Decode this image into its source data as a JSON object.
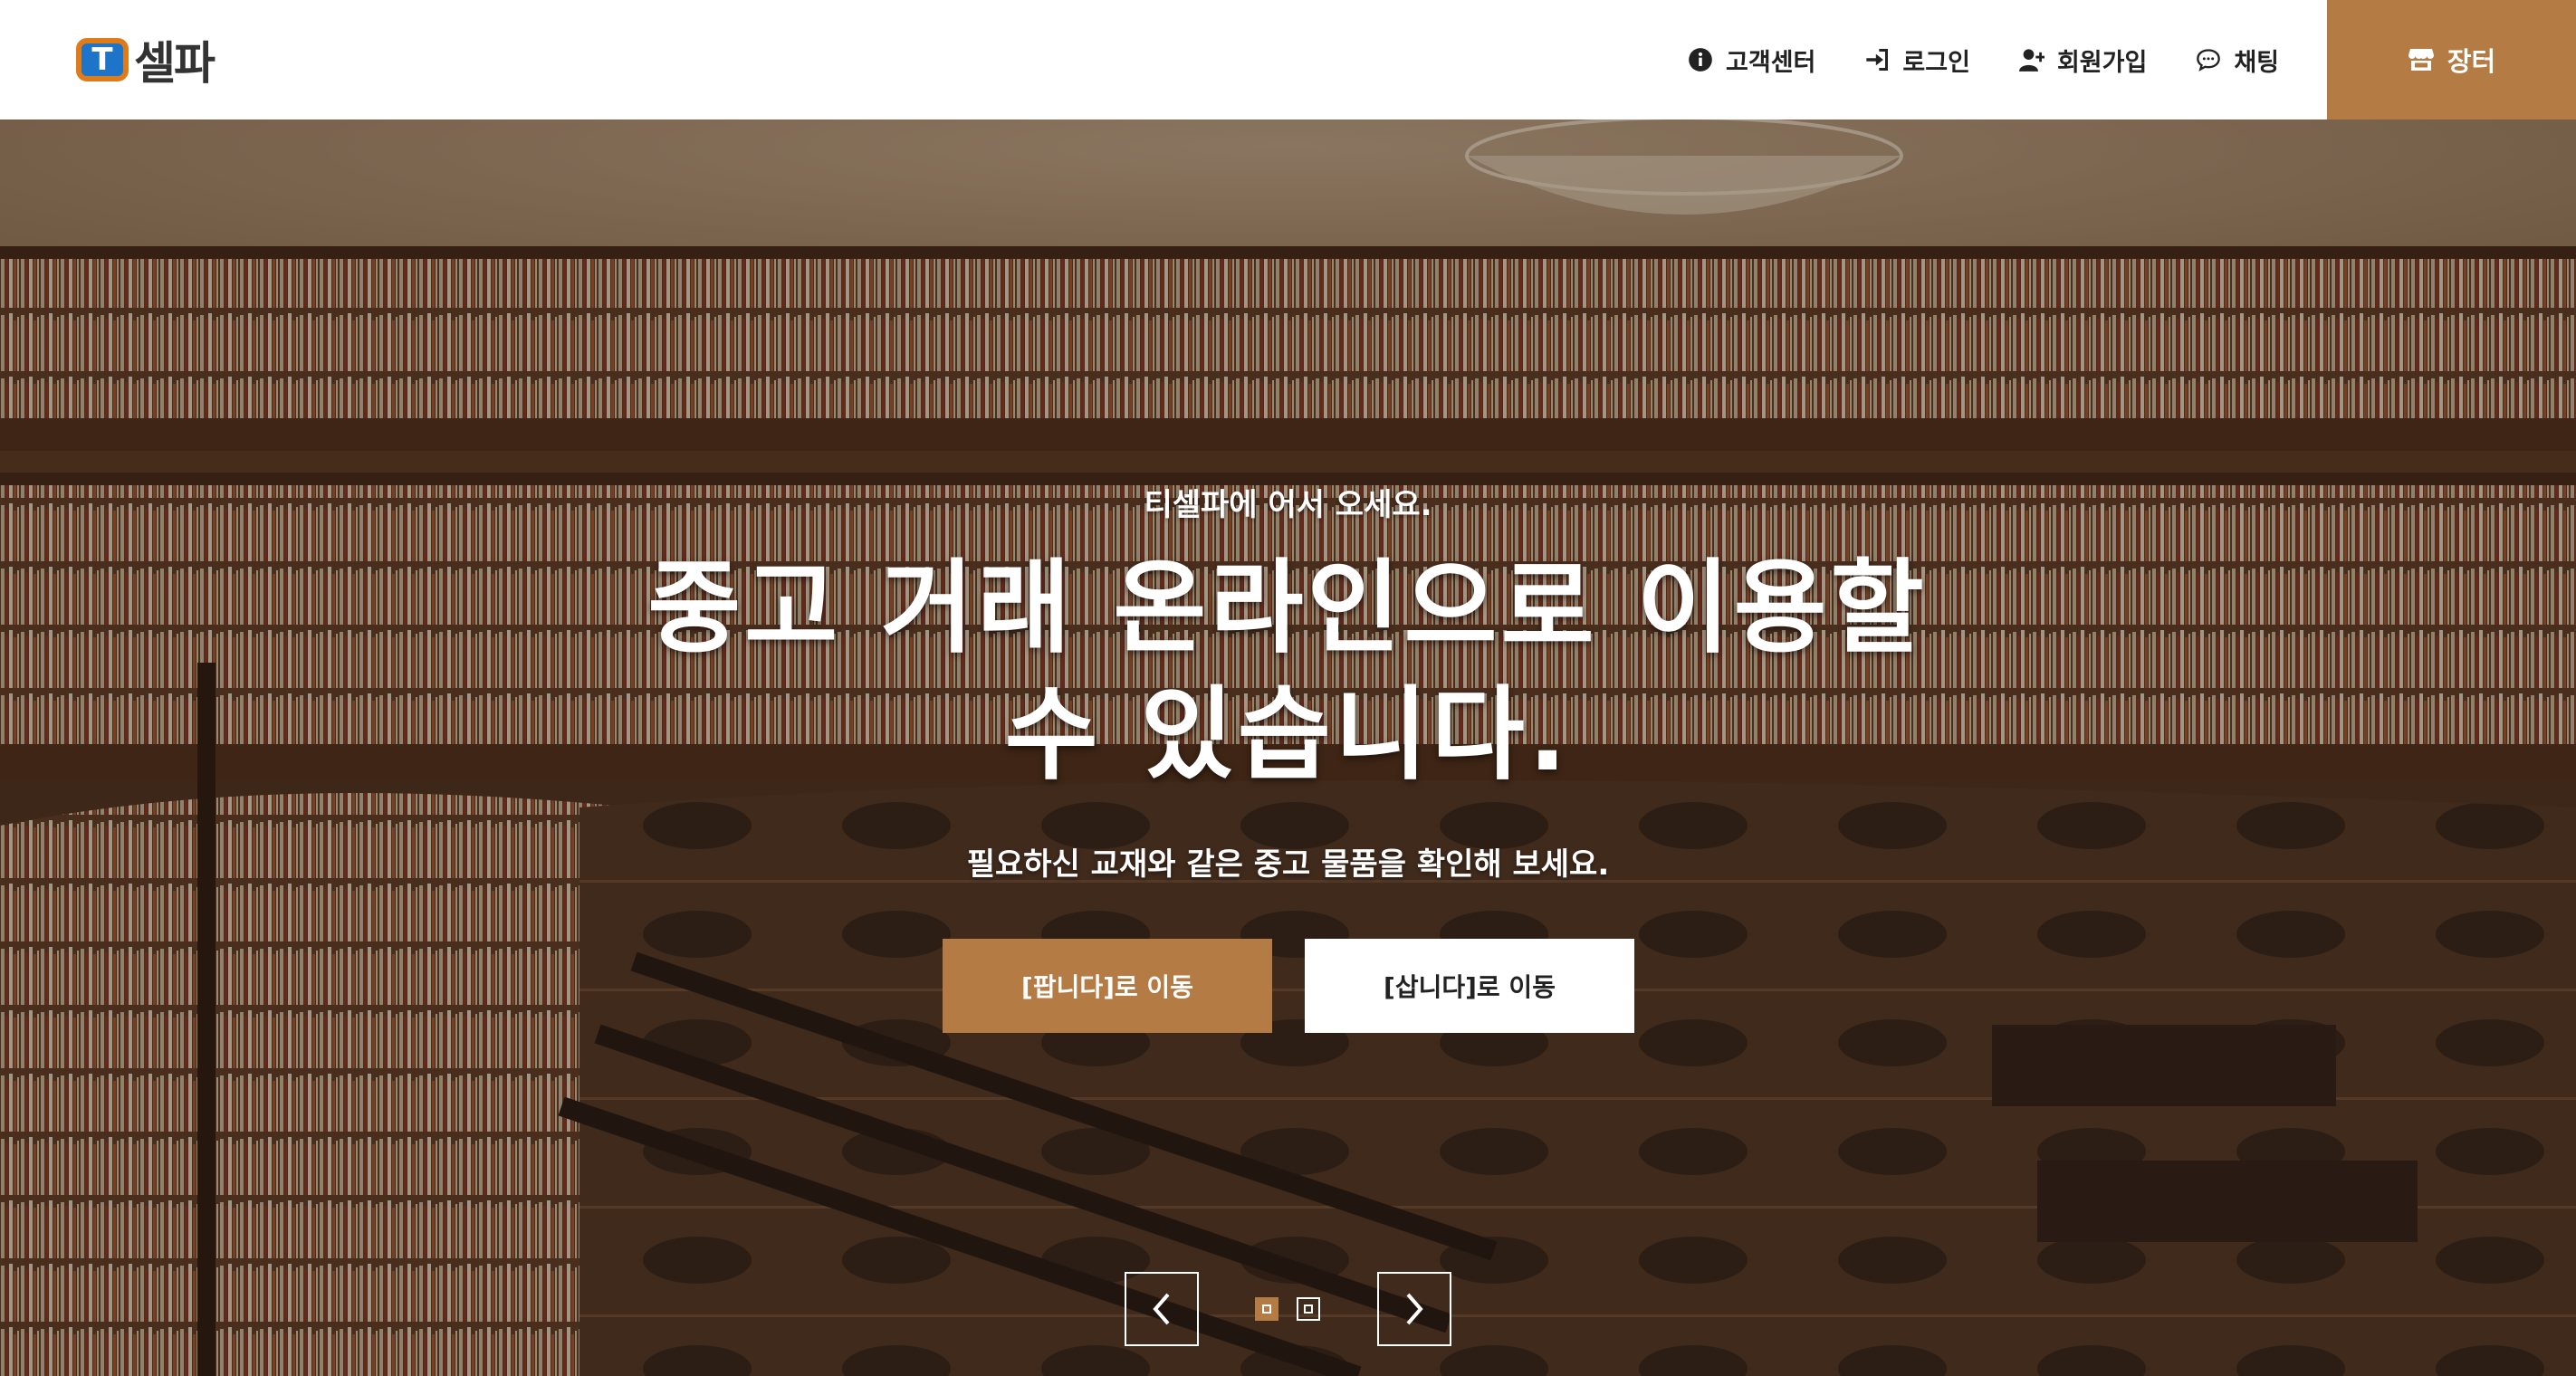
{
  "brand": {
    "logo_letter": "T",
    "name": "셀파",
    "accent_color": "#b47b45",
    "logo_orange": "#e07b1a",
    "logo_blue": "#1d74c8"
  },
  "nav": {
    "items": [
      {
        "label": "고객센터",
        "icon": "info-circle-icon"
      },
      {
        "label": "로그인",
        "icon": "sign-in-icon"
      },
      {
        "label": "회원가입",
        "icon": "user-plus-icon"
      },
      {
        "label": "채팅",
        "icon": "chat-bubble-icon"
      }
    ],
    "market": {
      "label": "장터",
      "icon": "store-icon"
    }
  },
  "hero": {
    "welcome": "티셀파에 어서 오세요.",
    "title_line1": "중고 거래 온라인으로 이용할",
    "title_line2": "수 있습니다.",
    "subtitle": "필요하신 교재와 같은 중고 물품을 확인해 보세요.",
    "cta_sell": "[팝니다]로 이동",
    "cta_buy": "[삽니다]로 이동",
    "slider": {
      "prev_icon": "chevron-left-icon",
      "next_icon": "chevron-right-icon",
      "dots": 2,
      "active_index": 0
    }
  }
}
